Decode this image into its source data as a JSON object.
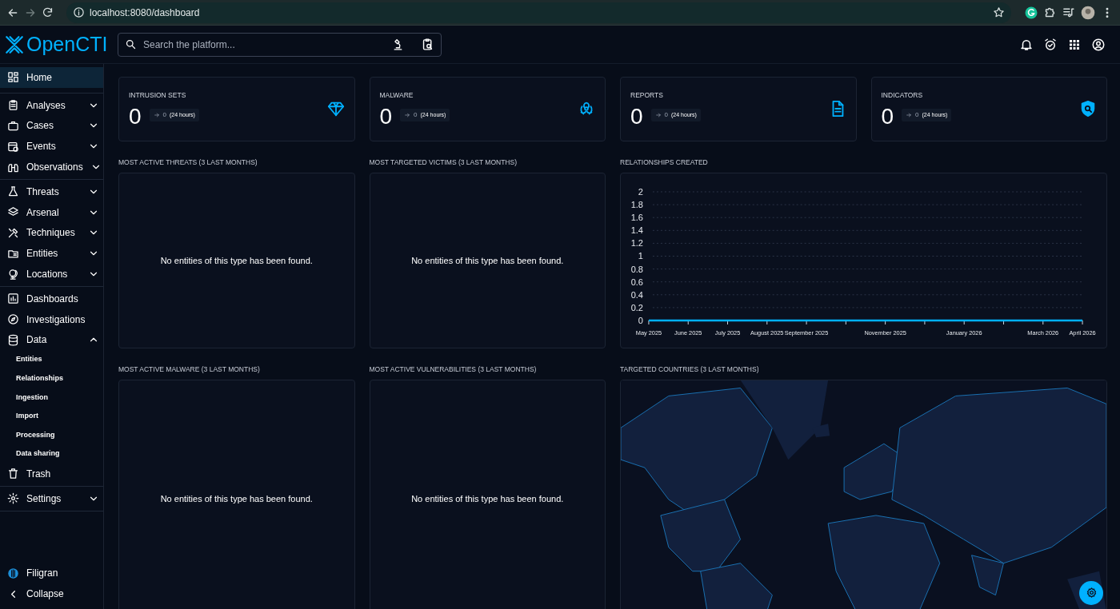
{
  "browser": {
    "url": "localhost:8080/dashboard"
  },
  "app": {
    "logo": "OpenCTI",
    "search": {
      "placeholder": "Search the platform..."
    }
  },
  "sidebar": {
    "groups": [
      [
        {
          "label": "Home",
          "selected": true
        }
      ],
      [
        {
          "label": "Analyses",
          "selected": false,
          "expanded": false
        },
        {
          "label": "Cases",
          "selected": false,
          "expanded": false
        },
        {
          "label": "Events",
          "selected": false,
          "expanded": false
        },
        {
          "label": "Observations",
          "selected": false,
          "expanded": false
        }
      ],
      [
        {
          "label": "Threats",
          "selected": false,
          "expanded": false
        },
        {
          "label": "Arsenal",
          "selected": false,
          "expanded": false
        },
        {
          "label": "Techniques",
          "selected": false,
          "expanded": false
        },
        {
          "label": "Entities",
          "selected": false,
          "expanded": false
        },
        {
          "label": "Locations",
          "selected": false,
          "expanded": false
        }
      ],
      [
        {
          "label": "Dashboards",
          "selected": false
        },
        {
          "label": "Investigations",
          "selected": false
        },
        {
          "label": "Data",
          "selected": false,
          "expanded": true,
          "children": [
            {
              "label": "Entities",
              "selected": false
            },
            {
              "label": "Relationships",
              "selected": false
            },
            {
              "label": "Ingestion",
              "selected": false
            },
            {
              "label": "Import",
              "selected": false
            },
            {
              "label": "Processing",
              "selected": false
            },
            {
              "label": "Data sharing",
              "selected": false
            }
          ]
        },
        {
          "label": "Trash",
          "selected": false
        }
      ],
      [
        {
          "label": "Settings",
          "selected": false,
          "expanded": false
        }
      ]
    ],
    "footer": [
      {
        "label": "Filigran"
      },
      {
        "label": "Collapse"
      }
    ]
  },
  "stats": [
    {
      "title": "INTRUSION SETS",
      "value": "0",
      "delta": "0",
      "period": "(24 hours)"
    },
    {
      "title": "MALWARE",
      "value": "0",
      "delta": "0",
      "period": "(24 hours)"
    },
    {
      "title": "REPORTS",
      "value": "0",
      "delta": "0",
      "period": "(24 hours)"
    },
    {
      "title": "INDICATORS",
      "value": "0",
      "delta": "0",
      "period": "(24 hours)"
    }
  ],
  "widgets": [
    {
      "title": "MOST ACTIVE THREATS (3 LAST MONTHS)",
      "kind": "empty",
      "message": "No entities of this type has been found."
    },
    {
      "title": "MOST TARGETED VICTIMS (3 LAST MONTHS)",
      "kind": "empty",
      "message": "No entities of this type has been found."
    },
    {
      "title": "RELATIONSHIPS CREATED",
      "kind": "chart",
      "chart_data": {
        "type": "line",
        "categories": [
          "May 2025",
          "June 2025",
          "July 2025",
          "August 2025",
          "September 2025",
          null,
          "November 2025",
          null,
          "January 2026",
          null,
          "March 2026",
          "April 2026"
        ],
        "series": [
          {
            "color": "#00b1ff",
            "values": [
              0,
              0,
              0,
              0,
              0,
              0,
              0,
              0,
              0,
              0,
              0,
              0
            ]
          }
        ],
        "grid": true,
        "ylim": [
          0,
          2
        ],
        "yticks": [
          0,
          0.2,
          0.4,
          0.6,
          0.8,
          1,
          1.2,
          1.4,
          1.6,
          1.8,
          2
        ]
      }
    },
    {
      "title": "MOST ACTIVE MALWARE (3 LAST MONTHS)",
      "kind": "empty",
      "message": "No entities of this type has been found."
    },
    {
      "title": "MOST ACTIVE VULNERABILITIES (3 LAST MONTHS)",
      "kind": "empty",
      "message": "No entities of this type has been found."
    },
    {
      "title": "TARGETED COUNTRIES (3 LAST MONTHS)",
      "kind": "map"
    }
  ]
}
